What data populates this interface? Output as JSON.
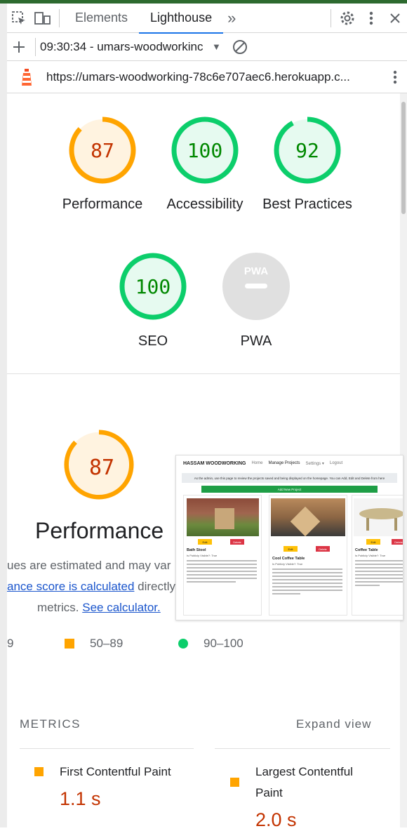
{
  "devtools": {
    "tabs": [
      "Elements",
      "Lighthouse"
    ],
    "more_tabs": "»"
  },
  "report_bar": {
    "time_label": "09:30:34 - umars-woodworkinϲ"
  },
  "url_bar": {
    "url": "https://umars-woodworking-78c6e707aec6.herokuapp.c..."
  },
  "scores": [
    {
      "label": "Performance",
      "value": "87",
      "score": 87,
      "color": "#ffa400",
      "text_color": "#c33300",
      "bg": "#fff3e0"
    },
    {
      "label": "Accessibility",
      "value": "100",
      "score": 100,
      "color": "#0cce6b",
      "text_color": "#008800",
      "bg": "#e6faf0"
    },
    {
      "label": "Best Practices",
      "value": "92",
      "score": 92,
      "color": "#0cce6b",
      "text_color": "#008800",
      "bg": "#e6faf0"
    },
    {
      "label": "SEO",
      "value": "100",
      "score": 100,
      "color": "#0cce6b",
      "text_color": "#008800",
      "bg": "#e6faf0"
    },
    {
      "label": "PWA",
      "value": "PWA",
      "score": null,
      "color": "#e0e0e0",
      "text_color": "#ffffff",
      "bg": "#e0e0e0"
    }
  ],
  "performance": {
    "value": "87",
    "title": "Performance",
    "line1": "ues are estimated and may var",
    "line2_link": "ance score is calculated",
    "line2_rest": " directly",
    "line3_prefix": "metrics. ",
    "line3_link": "See calculator."
  },
  "legend": {
    "first": "9",
    "mid": "50–89",
    "high": "90–100"
  },
  "metrics": {
    "heading": "METRICS",
    "expand": "Expand view",
    "items": [
      {
        "label": "First Contentful Paint",
        "value": "1.1 s"
      },
      {
        "label": "Largest Contentful Paint",
        "value": "2.0 s"
      }
    ]
  },
  "thumbnail": {
    "brand": "HASSAM WOODWORKING",
    "nav": [
      "Home",
      "Manage Projects",
      "Settings ▾",
      "Logout"
    ],
    "notice": "As the admin, use this page to review the projects saved and being displayed on the homepage. You can Add, Edit and Delete from here",
    "add_button": "Add New Project",
    "cards": [
      {
        "title": "Bath Stool",
        "sub": "Is Publicly Visible?: True",
        "edit": "Edit",
        "delete": "Delete"
      },
      {
        "title": "Cool Coffee Table",
        "sub": "Is Publicly Visible?: True",
        "edit": "Edit",
        "delete": "Delete"
      },
      {
        "title": "Coffee Table",
        "sub": "Is Publicly Visible?: True",
        "edit": "Edit",
        "delete": "Delete"
      }
    ]
  }
}
